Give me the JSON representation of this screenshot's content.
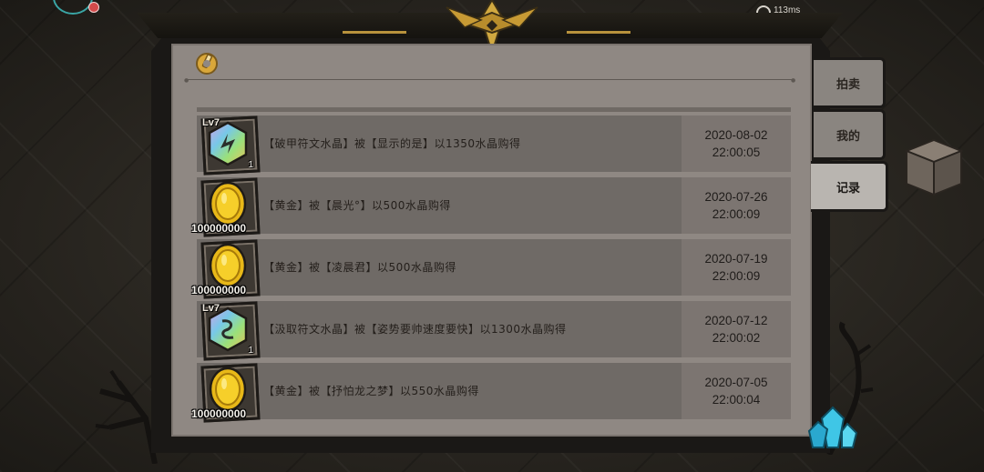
{
  "status": {
    "ping": "113ms"
  },
  "tabs": [
    {
      "label": "拍卖",
      "active": false
    },
    {
      "label": "我的",
      "active": false
    },
    {
      "label": "记录",
      "active": true
    }
  ],
  "records": [
    {
      "item": {
        "type": "rune",
        "level": "Lv7",
        "count": "1",
        "icon": "armor-break-rune-icon"
      },
      "description": "【破甲符文水晶】被【显示的是】以1350水晶购得",
      "date": "2020-08-02",
      "time": "22:00:05"
    },
    {
      "item": {
        "type": "gold",
        "level": "",
        "count": "100000000",
        "icon": "gold-coin-icon"
      },
      "description": "【黄金】被【晨光°】以500水晶购得",
      "date": "2020-07-26",
      "time": "22:00:09"
    },
    {
      "item": {
        "type": "gold",
        "level": "",
        "count": "100000000",
        "icon": "gold-coin-icon"
      },
      "description": "【黄金】被【凌晨君】以500水晶购得",
      "date": "2020-07-19",
      "time": "22:00:09"
    },
    {
      "item": {
        "type": "rune",
        "level": "Lv7",
        "count": "1",
        "icon": "leech-rune-icon"
      },
      "description": "【汲取符文水晶】被【姿势要帅速度要快】以1300水晶购得",
      "date": "2020-07-12",
      "time": "22:00:02"
    },
    {
      "item": {
        "type": "gold",
        "level": "",
        "count": "100000000",
        "icon": "gold-coin-icon"
      },
      "description": "【黄金】被【抒怕龙之梦】以550水晶购得",
      "date": "2020-07-05",
      "time": "22:00:04"
    }
  ],
  "colors": {
    "gold": "#e8b818",
    "panel": "#8f8883",
    "frame": "#1a1816"
  }
}
